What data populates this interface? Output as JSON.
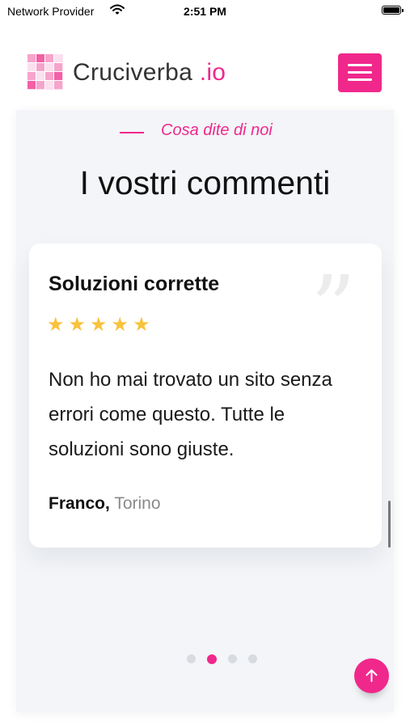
{
  "status_bar": {
    "carrier": "Network Provider",
    "time": "2:51 PM"
  },
  "header": {
    "logo_name": "Cruciverba",
    "logo_suffix": ".io",
    "brand_color": "#f0288c"
  },
  "testimonials": {
    "subtitle": "Cosa dite di noi",
    "title": "I vostri commenti",
    "card": {
      "title": "Soluzioni corrette",
      "rating": 5,
      "rating_max": 5,
      "text": "Non ho mai trovato un sito senza errori come questo. Tutte le soluzioni sono giuste.",
      "author": "Franco,",
      "city": "Torino"
    },
    "pagination": {
      "total": 4,
      "active_index": 1
    }
  },
  "icons": {
    "menu": "hamburger-icon",
    "back_to_top": "arrow-up-icon",
    "quote": "quote-icon",
    "star": "star-icon"
  }
}
